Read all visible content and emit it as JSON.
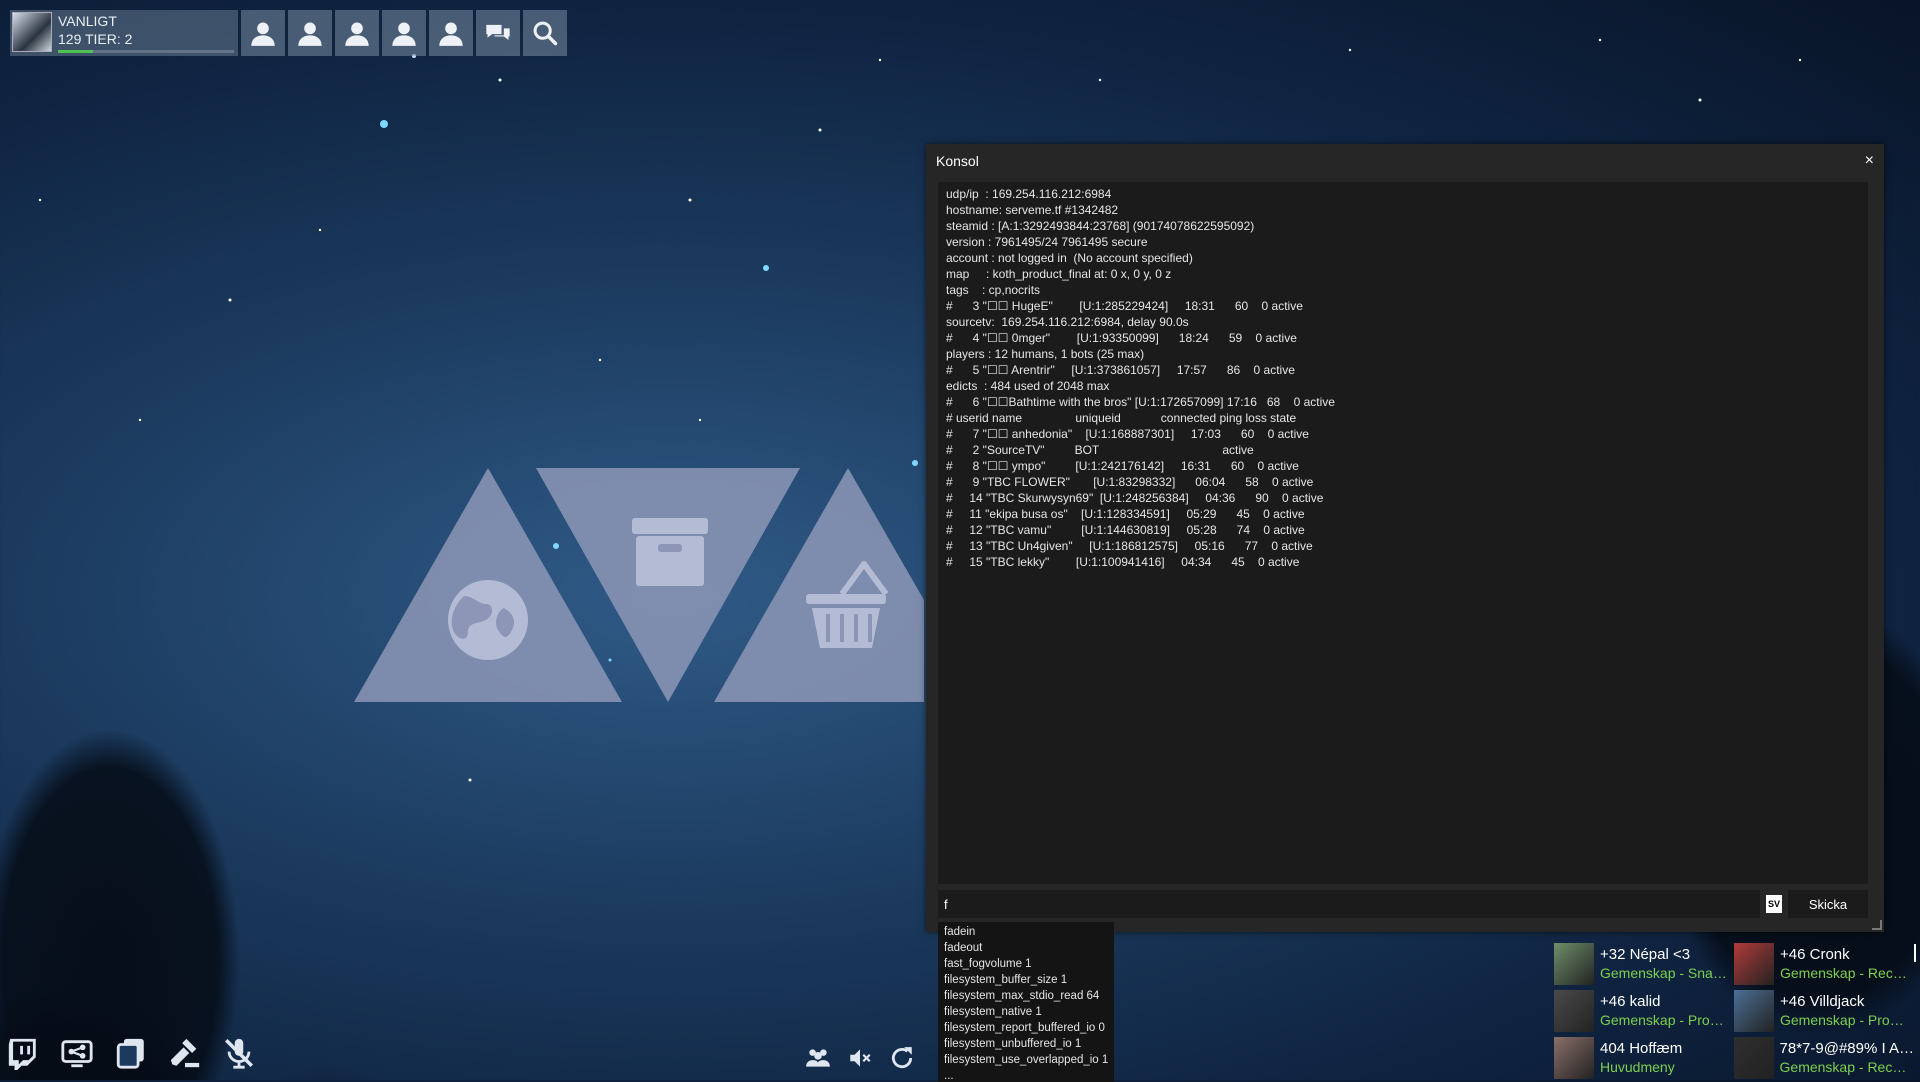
{
  "profile": {
    "name": "VANLIGT",
    "tier": "129 TIER: 2",
    "xp_progress": 0.2
  },
  "topbar_icons": [
    "friend-icon",
    "friend-icon",
    "friend-icon",
    "friend-icon",
    "friend-icon",
    "chat-icon",
    "search-icon"
  ],
  "console": {
    "title": "Konsol",
    "close_label": "×",
    "lines": [
      "udp/ip  : 169.254.116.212:6984",
      "hostname: serveme.tf #1342482",
      "steamid : [A:1:3292493844:23768] (90174078622595092)",
      "version : 7961495/24 7961495 secure",
      "account : not logged in  (No account specified)",
      "map     : koth_product_final at: 0 x, 0 y, 0 z",
      "tags    : cp,nocrits",
      "#      3 \"☐☐ HugeE\"        [U:1:285229424]     18:31      60    0 active",
      "sourcetv:  169.254.116.212:6984, delay 90.0s",
      "#      4 \"☐☐ 0mger\"        [U:1:93350099]      18:24      59    0 active",
      "players : 12 humans, 1 bots (25 max)",
      "#      5 \"☐☐ Arentrir\"     [U:1:373861057]     17:57      86    0 active",
      "edicts  : 484 used of 2048 max",
      "#      6 \"☐☐Bathtime with the bros\" [U:1:172657099] 17:16   68    0 active",
      "# userid name                uniqueid            connected ping loss state",
      "#      7 \"☐☐ anhedonia\"    [U:1:168887301]     17:03      60    0 active",
      "#      2 \"SourceTV\"         BOT                                     active",
      "#      8 \"☐☐ ympo\"         [U:1:242176142]     16:31      60    0 active",
      "#      9 \"TBC FLOWER\"       [U:1:83298332]      06:04      58    0 active",
      "#     14 \"TBC Skurwysyn69\"  [U:1:248256384]     04:36      90    0 active",
      "#     11 \"ekipa busa os\"    [U:1:128334591]     05:29      45    0 active",
      "#     12 \"TBC vamu\"         [U:1:144630819]     05:28      74    0 active",
      "#     13 \"TBC Un4given\"     [U:1:186812575]     05:16      77    0 active",
      "#     15 \"TBC lekky\"        [U:1:100941416]     04:34      45    0 active"
    ],
    "input_value": "f",
    "lang_badge": "SV",
    "send_label": "Skicka"
  },
  "autocomplete": [
    "fadein",
    "fadeout",
    "fast_fogvolume 1",
    "filesystem_buffer_size 1",
    "filesystem_max_stdio_read 64",
    "filesystem_native 1",
    "filesystem_report_buffered_io 0",
    "filesystem_unbuffered_io 1",
    "filesystem_use_overlapped_io 1",
    "..."
  ],
  "bottom_left_icons": [
    "twitch-icon",
    "network-icon",
    "copy-icon",
    "gavel-icon",
    "mic-muted-icon"
  ],
  "bottom_mid_icons": [
    "group-icon",
    "speaker-muted-icon",
    "refresh-icon"
  ],
  "friends": [
    {
      "name": "+32 Népal <3",
      "status": "Gemenskap - Snak…",
      "avatar_color": "#6f8f6a"
    },
    {
      "name": "+46 Cronk",
      "status": "Gemenskap - Rec…",
      "avatar_color": "#b23a3a"
    },
    {
      "name": "+46 kalid",
      "status": "Gemenskap - Proc…",
      "avatar_color": "#4a4a4a"
    },
    {
      "name": "+46 Villdjack",
      "status": "Gemenskap - Proc…",
      "avatar_color": "#4c6f96"
    },
    {
      "name": "404 Hoffæm",
      "status": "Huvudmeny",
      "avatar_color": "#8a6f6a"
    },
    {
      "name": "78*7-9@#89% I A…",
      "status": "Gemenskap - Rec…",
      "avatar_color": "#2e2e2e"
    }
  ],
  "colors": {
    "console_bg": "#262626",
    "output_bg": "#1b1b1b",
    "status_green": "#7bd04f",
    "triangle": "#8d96b6"
  }
}
